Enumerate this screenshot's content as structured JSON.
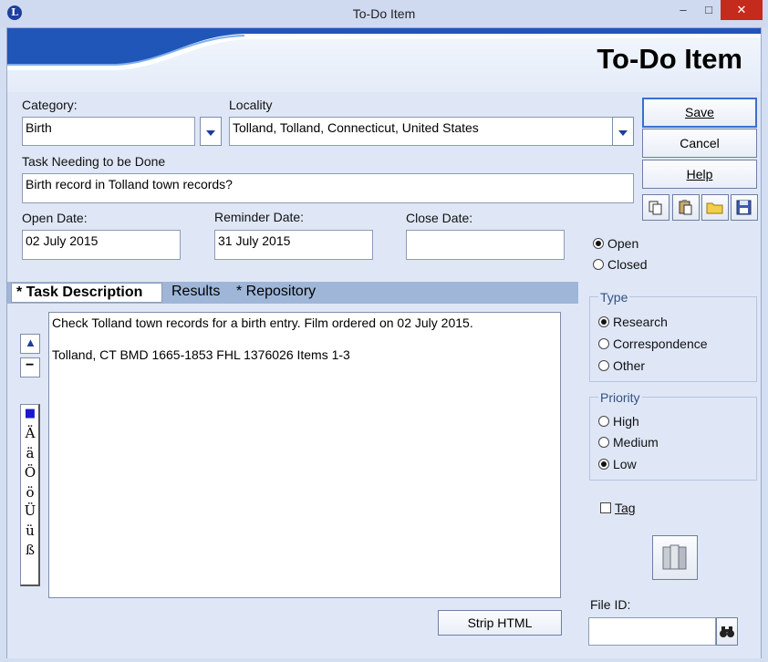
{
  "window": {
    "title": "To-Do Item",
    "app_icon": "L",
    "min": "–",
    "max": "□",
    "close": "✕"
  },
  "banner": {
    "title": "To-Do Item"
  },
  "category": {
    "label": "Category:",
    "value": "Birth"
  },
  "locality": {
    "label": "Locality",
    "value": "Tolland, Tolland, Connecticut, United States"
  },
  "task": {
    "label": "Task Needing to be Done",
    "value": "Birth record in Tolland town records?"
  },
  "dates": {
    "open_label": "Open Date:",
    "open_value": "02 July 2015",
    "reminder_label": "Reminder Date:",
    "reminder_value": "31 July 2015",
    "close_label": "Close Date:",
    "close_value": ""
  },
  "buttons": {
    "save": "Save",
    "cancel": "Cancel",
    "help": "Help",
    "strip_html": "Strip HTML"
  },
  "icons": [
    "copy-icon",
    "paste-icon",
    "folder-icon",
    "floppy-icon",
    "book-icon",
    "binoculars-icon"
  ],
  "status": {
    "open": "Open",
    "closed": "Closed",
    "selected": "Open"
  },
  "type": {
    "title": "Type",
    "research": "Research",
    "correspondence": "Correspondence",
    "other": "Other",
    "selected": "Research"
  },
  "priority": {
    "title": "Priority",
    "high": "High",
    "medium": "Medium",
    "low": "Low",
    "selected": "Low"
  },
  "tag": {
    "label": "Tag",
    "checked": false
  },
  "file_id": {
    "label": "File ID:",
    "value": ""
  },
  "tabs": {
    "description": "* Task Description",
    "results": "Results",
    "repository": "* Repository",
    "active": "* Task Description"
  },
  "description_text": {
    "line1": "Check Tolland town records for a birth entry. Film ordered on 02 July 2015.",
    "line2": "Tolland, CT BMD 1665-1853 FHL 1376026 Items 1-3"
  },
  "editor": {
    "up": "▲",
    "minus": "−"
  },
  "special_chars": [
    "■",
    "Ä",
    "ä",
    "Ö",
    "ö",
    "Ü",
    "ü",
    "ß"
  ],
  "colors": {
    "accent": "#1b3d9a",
    "banner_blue": "#1f56b8",
    "close_red": "#c42b1c"
  }
}
